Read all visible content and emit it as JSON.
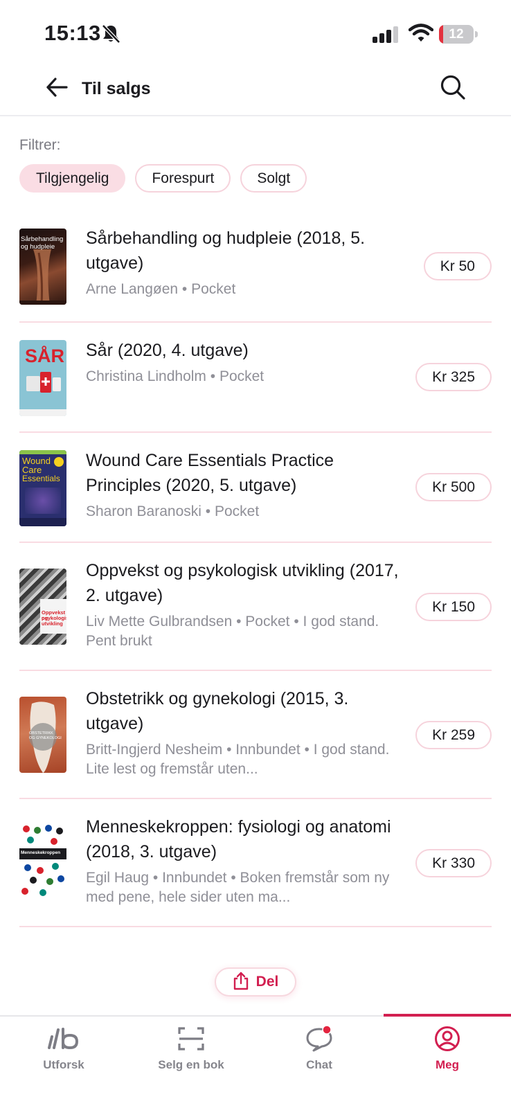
{
  "status_bar": {
    "time": "15:13",
    "battery_level": "12",
    "battery_fraction": 0.12,
    "icons": [
      "bell-slash-icon",
      "cellular-signal-icon",
      "wifi-icon",
      "battery-icon"
    ]
  },
  "header": {
    "back_icon": "arrow-left-icon",
    "title": "Til salgs",
    "search_icon": "search-icon"
  },
  "filters": {
    "label": "Filtrer:",
    "chips": [
      {
        "label": "Tilgjengelig",
        "active": true
      },
      {
        "label": "Forespurt",
        "active": false
      },
      {
        "label": "Solgt",
        "active": false
      }
    ]
  },
  "books": [
    {
      "title": "Sårbehandling og hudpleie (2018, 5. utgave)",
      "meta": "Arne Langøen • Pocket",
      "price": "Kr 50",
      "cover_text": [
        "Sårbehandling",
        "og hudpleie"
      ]
    },
    {
      "title": "Sår (2020, 4. utgave)",
      "meta": "Christina Lindholm • Pocket",
      "price": "Kr 325",
      "cover_text": [
        "SÅR"
      ]
    },
    {
      "title": "Wound Care Essentials Practice Principles (2020, 5. utgave)",
      "meta": "Sharon Baranoski • Pocket",
      "price": "Kr 500",
      "cover_text": [
        "Wound",
        "Care",
        "Essentials"
      ]
    },
    {
      "title": "Oppvekst og psykologisk utvikling (2017, 2. utgave)",
      "meta": "Liv Mette Gulbrandsen • Pocket • I god stand. Pent brukt",
      "price": "Kr 150",
      "cover_text": [
        "Oppvekst og",
        "psykologisk",
        "utvikling"
      ]
    },
    {
      "title": "Obstetrikk og gynekologi (2015, 3. utgave)",
      "meta": "Britt-Ingjerd Nesheim • Innbundet • I god stand. Lite lest og fremstår uten...",
      "price": "Kr 259",
      "cover_text": [
        "OBSTETRIKK",
        "OG GYNEKOLOGI"
      ]
    },
    {
      "title": "Menneskekroppen: fysiologi og anatomi (2018, 3. utgave)",
      "meta": "Egil Haug • Innbundet • Boken fremstår som ny med pene, hele sider uten ma...",
      "price": "Kr 330",
      "cover_text": [
        "Menneskekroppen"
      ]
    }
  ],
  "share": {
    "label": "Del",
    "icon": "share-icon"
  },
  "nav": {
    "items": [
      {
        "label": "Utforsk",
        "icon": "logo-icon",
        "active": false
      },
      {
        "label": "Selg en bok",
        "icon": "scan-icon",
        "active": false
      },
      {
        "label": "Chat",
        "icon": "chat-icon",
        "active": false,
        "badge": true
      },
      {
        "label": "Meg",
        "icon": "profile-icon",
        "active": true
      }
    ]
  },
  "colors": {
    "accent": "#d21f50",
    "chip_active_bg": "#fadde4",
    "chip_border": "#f6d3dc",
    "divider": "#f9dbe2",
    "muted_text": "#8f8f97"
  }
}
